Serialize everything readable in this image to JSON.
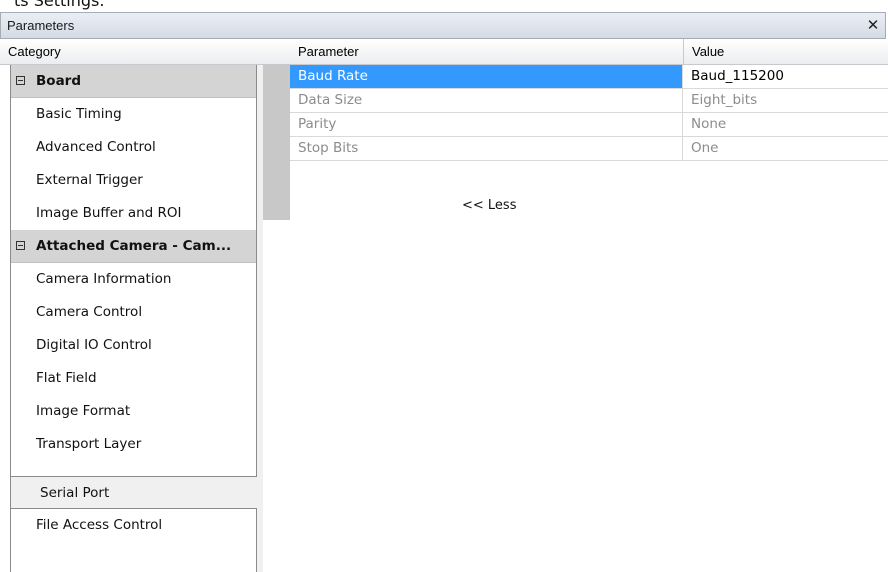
{
  "window": {
    "title": "Parameters",
    "close_glyph": "✕"
  },
  "headers": {
    "category": "Category",
    "parameter": "Parameter",
    "value": "Value"
  },
  "categories": [
    {
      "label": "Board",
      "type": "group"
    },
    {
      "label": "Basic Timing",
      "type": "item"
    },
    {
      "label": "Advanced Control",
      "type": "item"
    },
    {
      "label": "External Trigger",
      "type": "item"
    },
    {
      "label": "Image Buffer and ROI",
      "type": "item"
    },
    {
      "label": "Attached Camera - Cam...",
      "type": "group"
    },
    {
      "label": "Camera Information",
      "type": "item"
    },
    {
      "label": "Camera Control",
      "type": "item"
    },
    {
      "label": "Digital IO Control",
      "type": "item"
    },
    {
      "label": "Flat Field",
      "type": "item"
    },
    {
      "label": "Image Format",
      "type": "item"
    },
    {
      "label": "Transport Layer",
      "type": "item"
    },
    {
      "label": "Serial Port",
      "type": "item",
      "selected": true
    },
    {
      "label": "File Access Control",
      "type": "item"
    }
  ],
  "parameters": [
    {
      "name": "Baud Rate",
      "value": "Baud_115200",
      "active": true
    },
    {
      "name": "Data Size",
      "value": "Eight_bits"
    },
    {
      "name": "Parity",
      "value": "None"
    },
    {
      "name": "Stop Bits",
      "value": "One"
    }
  ],
  "less_link": "<< Less",
  "colors": {
    "selection": "#3399ff",
    "category_bg": "#d4d4d4",
    "disabled_text": "#8c8c8c"
  }
}
